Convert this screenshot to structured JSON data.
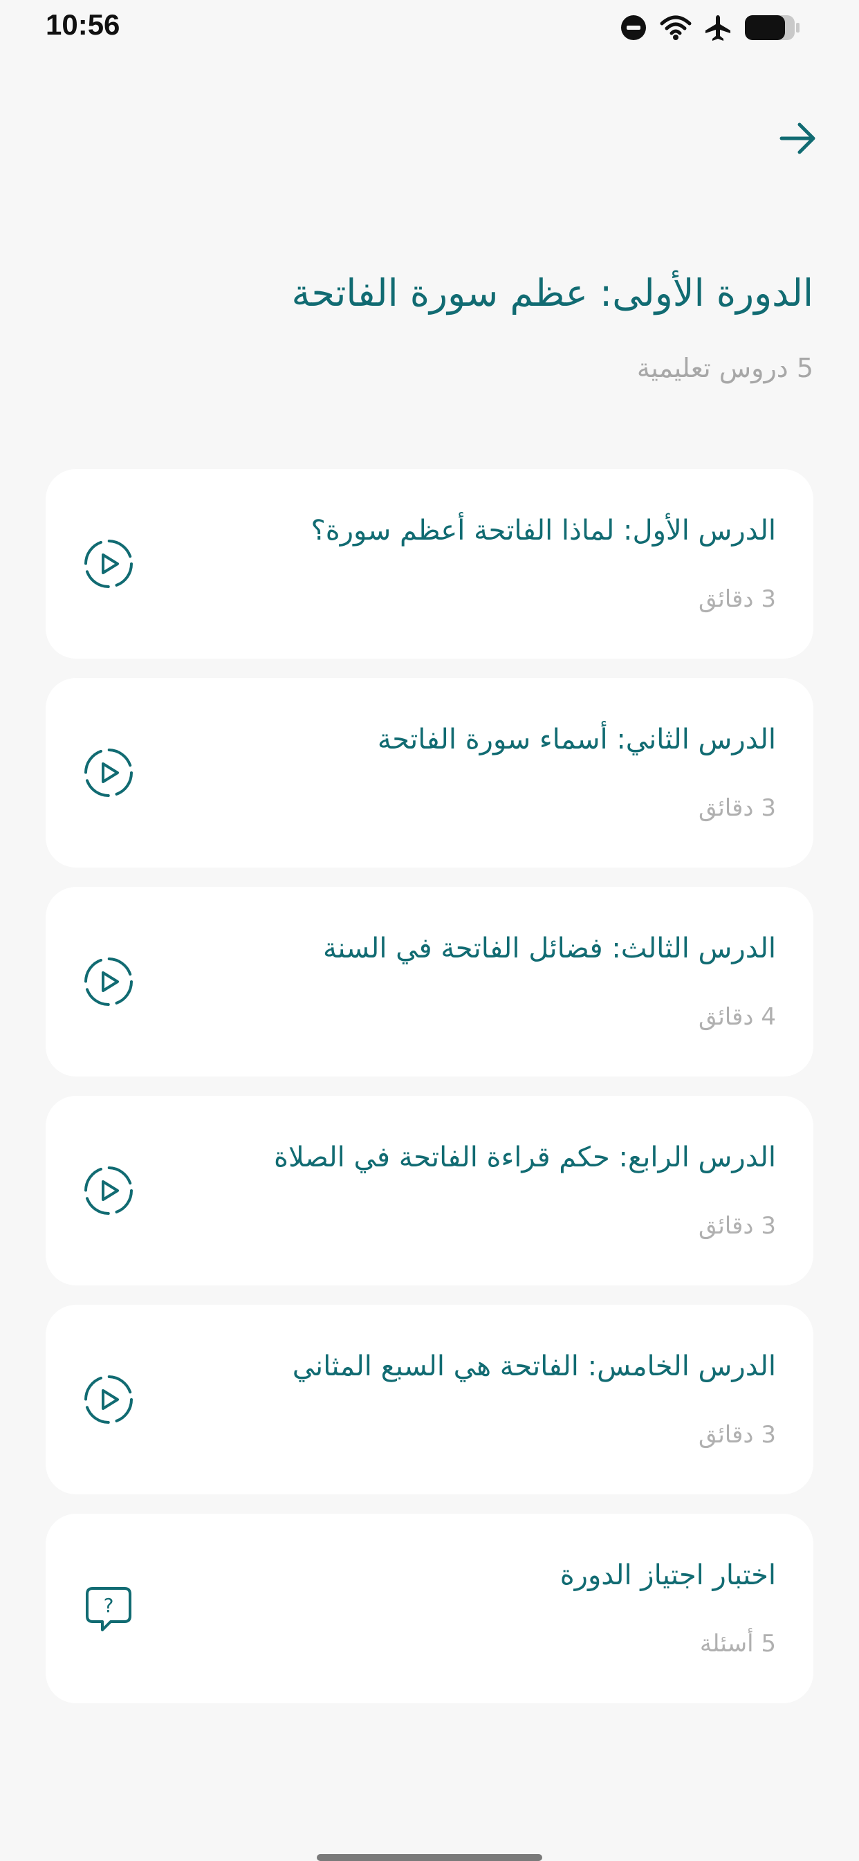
{
  "status_bar": {
    "time": "10:56",
    "icons": [
      "do-not-disturb-icon",
      "wifi-icon",
      "airplane-icon",
      "battery-icon"
    ]
  },
  "header": {
    "back_icon": "arrow-right-icon"
  },
  "course": {
    "title": "الدورة الأولى: عظم سورة الفاتحة",
    "subtitle": "5 دروس تعليمية"
  },
  "lessons": [
    {
      "title": "الدرس الأول: لماذا الفاتحة أعظم سورة؟",
      "meta": "3 دقائق",
      "icon": "play-circle-icon"
    },
    {
      "title": "الدرس الثاني: أسماء سورة الفاتحة",
      "meta": "3 دقائق",
      "icon": "play-circle-icon"
    },
    {
      "title": "الدرس الثالث: فضائل الفاتحة في السنة",
      "meta": "4 دقائق",
      "icon": "play-circle-icon"
    },
    {
      "title": "الدرس الرابع: حكم قراءة الفاتحة في الصلاة",
      "meta": "3 دقائق",
      "icon": "play-circle-icon"
    },
    {
      "title": "الدرس الخامس: الفاتحة هي السبع المثاني",
      "meta": "3 دقائق",
      "icon": "play-circle-icon"
    },
    {
      "title": "اختبار اجتياز الدورة",
      "meta": "5 أسئلة",
      "icon": "quiz-bubble-icon"
    }
  ],
  "colors": {
    "accent": "#116b72",
    "background": "#f7f7f7",
    "card": "#ffffff",
    "muted_text": "#a7a7a7"
  }
}
